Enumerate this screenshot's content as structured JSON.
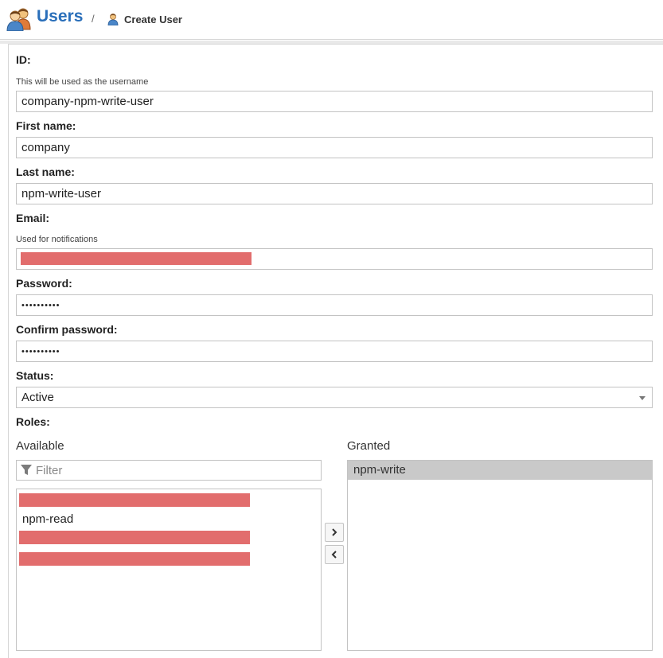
{
  "header": {
    "title": "Users",
    "separator": "/",
    "crumb": "Create User",
    "icons": {
      "section": "users-icon",
      "crumb": "user-icon"
    }
  },
  "form": {
    "id": {
      "label": "ID:",
      "help": "This will be used as the username",
      "value": "company-npm-write-user"
    },
    "first_name": {
      "label": "First name:",
      "value": "company"
    },
    "last_name": {
      "label": "Last name:",
      "value": "npm-write-user"
    },
    "email": {
      "label": "Email:",
      "help": "Used for notifications",
      "value": ""
    },
    "password": {
      "label": "Password:",
      "value": "••••••••••"
    },
    "confirm_password": {
      "label": "Confirm password:",
      "value": "••••••••••"
    },
    "status": {
      "label": "Status:",
      "value": "Active"
    },
    "roles": {
      "label": "Roles:",
      "available": {
        "heading": "Available",
        "filter_placeholder": "Filter",
        "items": [
          "npm-read"
        ]
      },
      "granted": {
        "heading": "Granted",
        "items": [
          "npm-write"
        ]
      }
    }
  },
  "colors": {
    "accent": "#2a6fba",
    "redaction": "#e26d6d",
    "selected_row": "#c9c9c9"
  }
}
